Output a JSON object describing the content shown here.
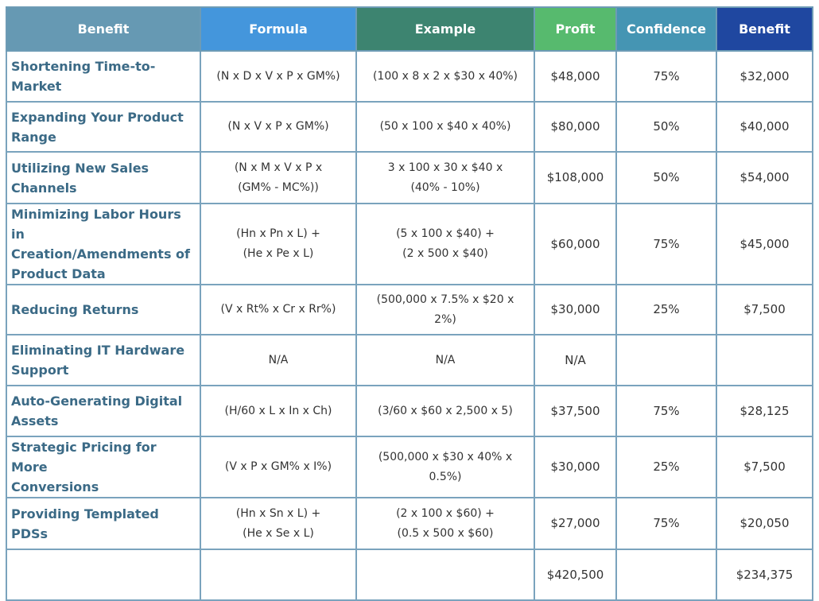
{
  "headers": {
    "benefit": "Benefit",
    "formula": "Formula",
    "example": "Example",
    "profit": "Profit",
    "confidence": "Confidence",
    "benefit_value": "Benefit"
  },
  "header_colors": {
    "benefit": "#6699b3",
    "formula": "#4496dc",
    "example": "#3d8470",
    "profit": "#57ba6e",
    "confidence": "#4595b3",
    "benefit_value": "#1f47a0"
  },
  "rows": [
    {
      "name": [
        "Shortening Time-to-",
        "Market"
      ],
      "formula": [
        "(N x D x V x P x GM%)"
      ],
      "example": [
        "(100 x 8 x 2 x $30 x 40%)"
      ],
      "profit": "$48,000",
      "confidence": "75%",
      "benefit": "$32,000"
    },
    {
      "name": [
        "Expanding Your Product",
        "Range"
      ],
      "formula": [
        "(N x V x P x GM%)"
      ],
      "example": [
        "(50 x 100 x $40 x 40%)"
      ],
      "profit": "$80,000",
      "confidence": "50%",
      "benefit": "$40,000"
    },
    {
      "name": [
        "Utilizing New Sales",
        "Channels"
      ],
      "formula": [
        "(N x M x V x P x",
        "(GM% - MC%))"
      ],
      "example": [
        "3 x 100 x 30 x $40 x",
        "(40% - 10%)"
      ],
      "profit": "$108,000",
      "confidence": "50%",
      "benefit": "$54,000"
    },
    {
      "name": [
        "Minimizing Labor Hours in",
        "Creation/Amendments of",
        "Product Data"
      ],
      "formula": [
        "(Hn x Pn x L) +",
        "(He x Pe x L)"
      ],
      "example": [
        "(5 x 100 x $40) +",
        "(2 x 500 x $40)"
      ],
      "profit": "$60,000",
      "confidence": "75%",
      "benefit": "$45,000"
    },
    {
      "name": [
        "Reducing Returns"
      ],
      "formula": [
        "(V x Rt% x Cr x Rr%)"
      ],
      "example": [
        "(500,000 x 7.5% x $20 x",
        "2%)"
      ],
      "profit": "$30,000",
      "confidence": "25%",
      "benefit": "$7,500"
    },
    {
      "name": [
        "Eliminating IT Hardware",
        "Support"
      ],
      "formula": [
        "N/A"
      ],
      "example": [
        "N/A"
      ],
      "profit": "N/A",
      "confidence": "",
      "benefit": ""
    },
    {
      "name": [
        "Auto-Generating Digital",
        "Assets"
      ],
      "formula": [
        "(H/60 x L x In x Ch)"
      ],
      "example": [
        "(3/60 x $60 x 2,500 x 5)"
      ],
      "profit": "$37,500",
      "confidence": "75%",
      "benefit": "$28,125"
    },
    {
      "name": [
        "Strategic Pricing for More",
        "Conversions"
      ],
      "formula": [
        "(V x P x GM% x I%)"
      ],
      "example": [
        "(500,000 x $30 x 40% x",
        "0.5%)"
      ],
      "profit": "$30,000",
      "confidence": "25%",
      "benefit": "$7,500"
    },
    {
      "name": [
        "Providing Templated",
        "PDSs"
      ],
      "formula": [
        "(Hn x Sn x L) +",
        "(He x Se x L)"
      ],
      "example": [
        "(2 x 100 x $60) +",
        "(0.5 x 500 x $60)"
      ],
      "profit": "$27,000",
      "confidence": "75%",
      "benefit": "$20,050"
    }
  ],
  "totals": {
    "name": "",
    "formula": "",
    "example": "",
    "profit": "$420,500",
    "confidence": "",
    "benefit": "$234,375"
  }
}
